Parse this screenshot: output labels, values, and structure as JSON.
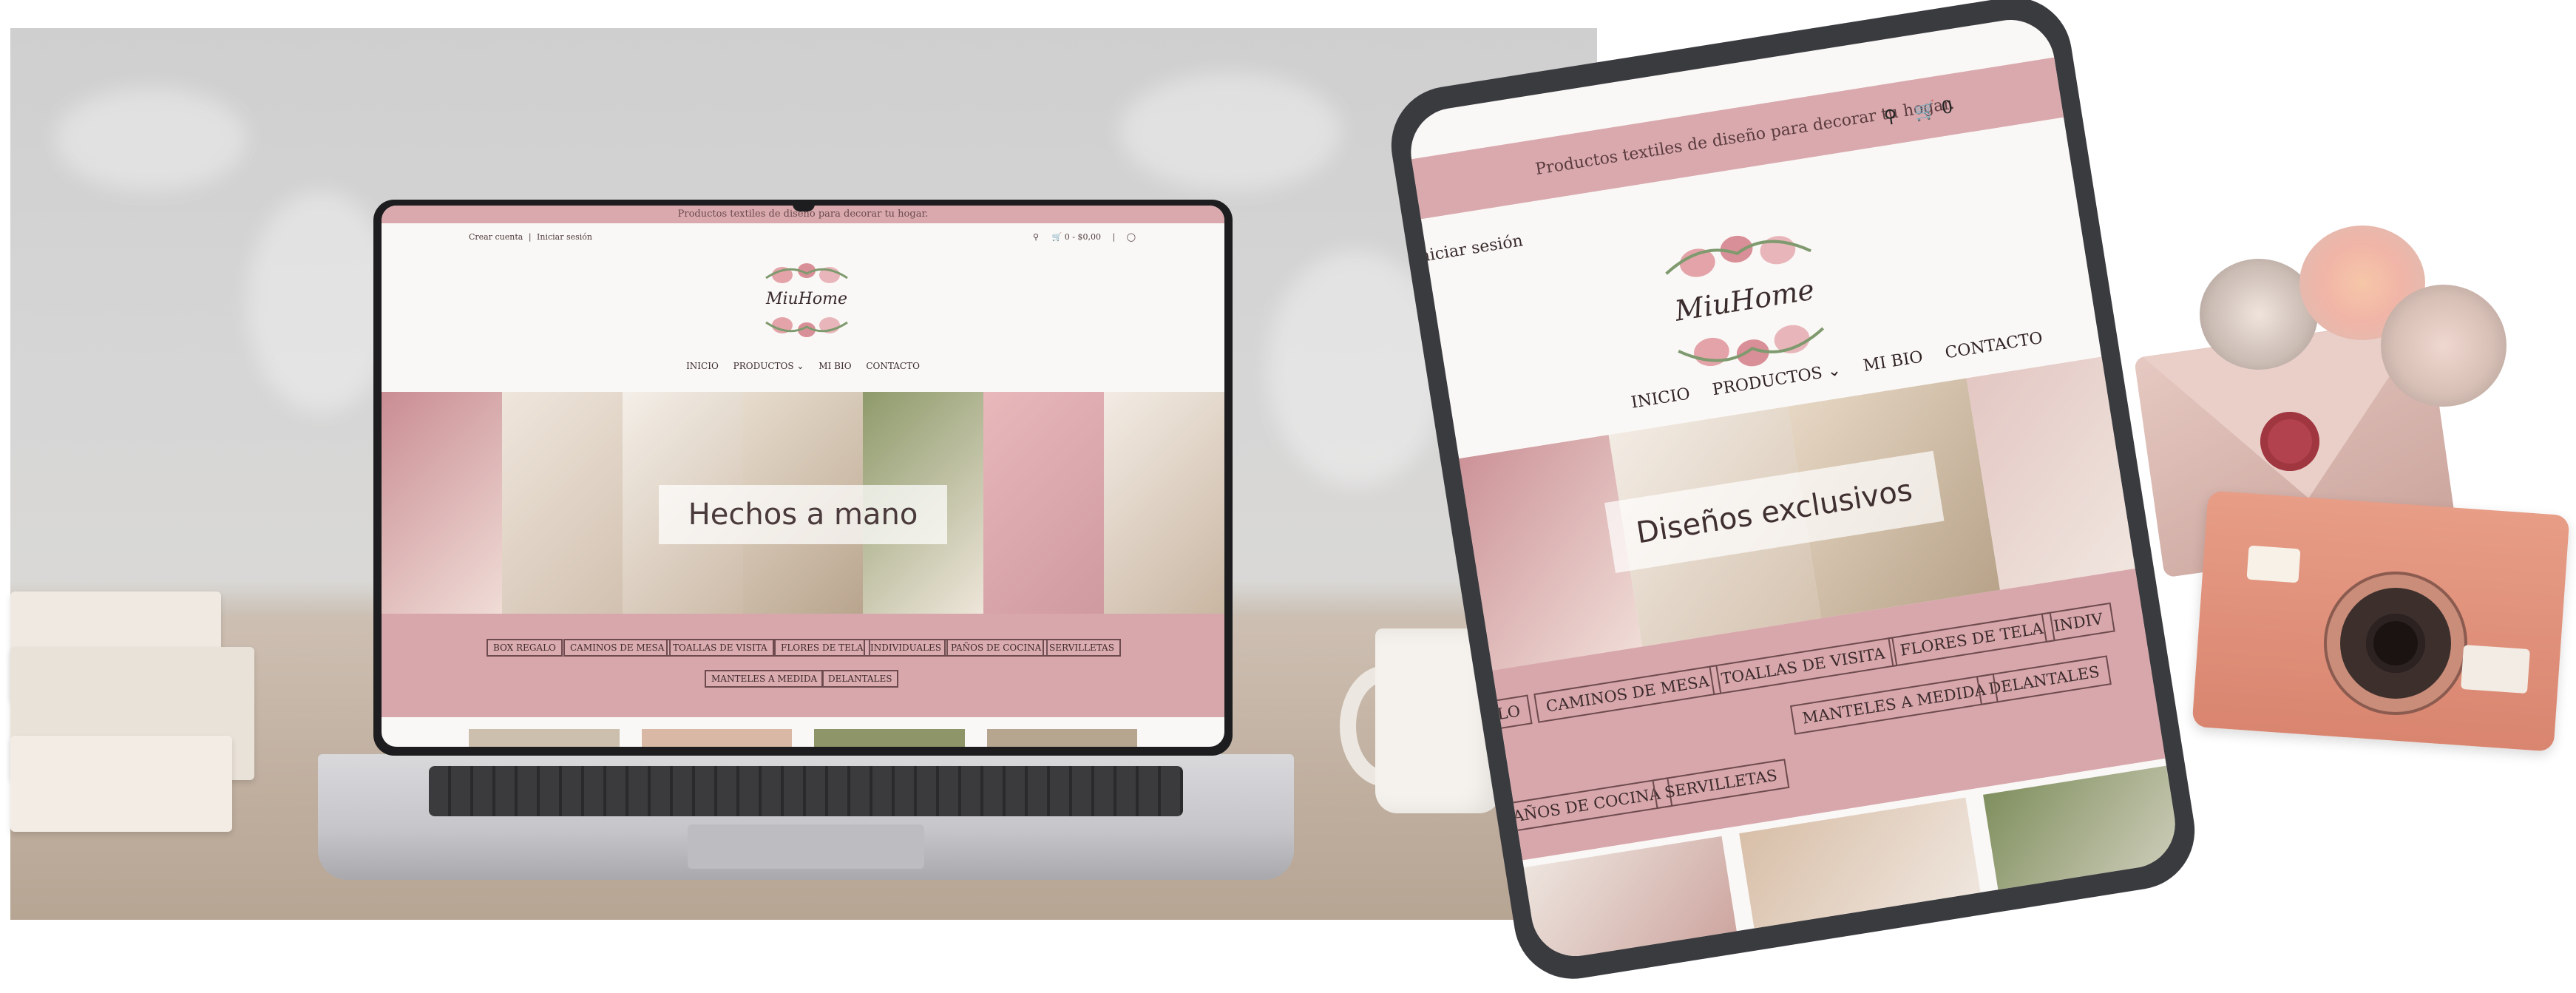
{
  "laptop": {
    "banner": "Productos textiles de diseño para decorar tu hogar.",
    "header": {
      "create_account": "Crear cuenta",
      "separator": "|",
      "login": "Iniciar sesión",
      "cart": "0 - $0,00"
    },
    "logo_text": "MiuHome",
    "nav": [
      "INICIO",
      "PRODUCTOS",
      "MI BIO",
      "CONTACTO"
    ],
    "hero_title": "Hechos a mano",
    "categories_row1": [
      "BOX REGALO",
      "CAMINOS DE MESA",
      "TOALLAS DE VISITA",
      "FLORES DE TELA",
      "INDIVIDUALES",
      "PAÑOS DE COCINA",
      "SERVILLETAS"
    ],
    "categories_row2": [
      "MANTELES A MEDIDA",
      "DELANTALES"
    ]
  },
  "tablet": {
    "banner": "Productos textiles de diseño para decorar tu hogar.",
    "login": "niciar sesión",
    "cart_count": "0",
    "logo_text": "MiuHome",
    "nav": [
      "INICIO",
      "PRODUCTOS",
      "MI BIO",
      "CONTACTO"
    ],
    "hero_title": "Diseños exclusivos",
    "categories_row1": [
      "CAMINOS DE MESA",
      "TOALLAS DE VISITA",
      "FLORES DE TELA",
      "INDIV"
    ],
    "categories_row1_prefix": "ALO",
    "categories_row2": [
      "MANTELES A MEDIDA",
      "DELANTALES"
    ],
    "categories_row3": [
      "PAÑOS DE COCINA",
      "SERVILLETAS"
    ]
  },
  "colors": {
    "brand_pink": "#d9a9ad",
    "text_dark": "#3a2c2d"
  },
  "icons": {
    "search": "search-icon",
    "cart": "cart-icon",
    "instagram": "instagram-icon",
    "chevron": "chevron-down-icon"
  }
}
